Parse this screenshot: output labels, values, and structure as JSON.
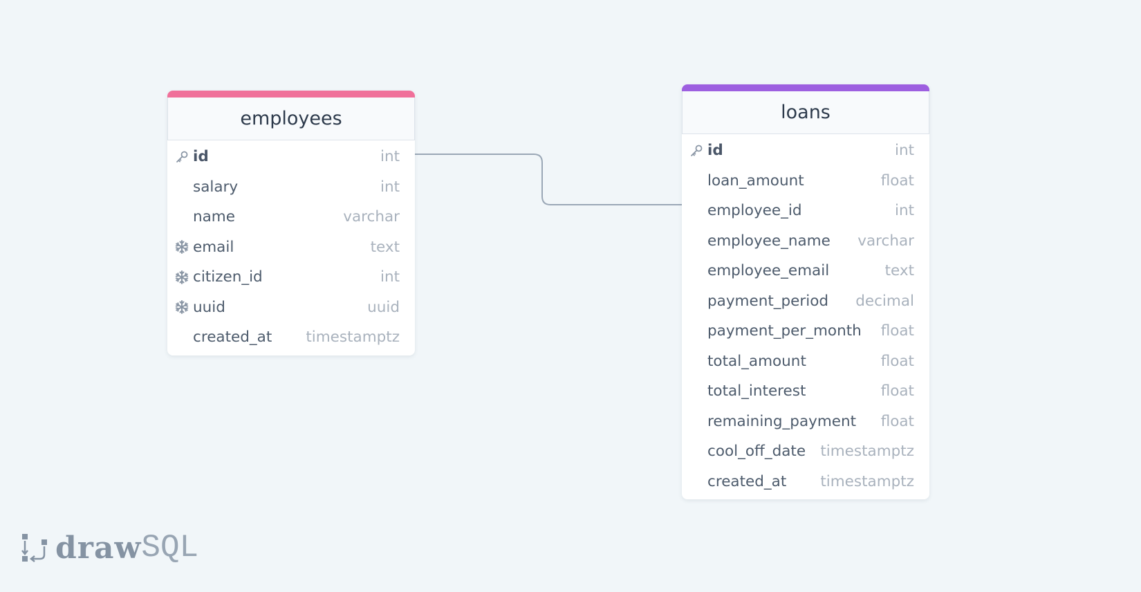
{
  "colors": {
    "employees_accent": "#f0709a",
    "loans_accent": "#9d5fe0",
    "connector": "#9aa7b6",
    "icon": "#8a96a5"
  },
  "tables": {
    "employees": {
      "name": "employees",
      "columns": [
        {
          "name": "id",
          "type": "int",
          "icon": "key-icon",
          "primary": true
        },
        {
          "name": "salary",
          "type": "int",
          "icon": null
        },
        {
          "name": "name",
          "type": "varchar",
          "icon": null
        },
        {
          "name": "email",
          "type": "text",
          "icon": "snowflake-icon"
        },
        {
          "name": "citizen_id",
          "type": "int",
          "icon": "snowflake-icon"
        },
        {
          "name": "uuid",
          "type": "uuid",
          "icon": "snowflake-icon"
        },
        {
          "name": "created_at",
          "type": "timestamptz",
          "icon": null
        }
      ]
    },
    "loans": {
      "name": "loans",
      "columns": [
        {
          "name": "id",
          "type": "int",
          "icon": "key-icon",
          "primary": true
        },
        {
          "name": "loan_amount",
          "type": "float",
          "icon": null
        },
        {
          "name": "employee_id",
          "type": "int",
          "icon": null
        },
        {
          "name": "employee_name",
          "type": "varchar",
          "icon": null
        },
        {
          "name": "employee_email",
          "type": "text",
          "icon": null
        },
        {
          "name": "payment_period",
          "type": "decimal",
          "icon": null
        },
        {
          "name": "payment_per_month",
          "type": "float",
          "icon": null
        },
        {
          "name": "total_amount",
          "type": "float",
          "icon": null
        },
        {
          "name": "total_interest",
          "type": "float",
          "icon": null
        },
        {
          "name": "remaining_payment",
          "type": "float",
          "icon": null
        },
        {
          "name": "cool_off_date",
          "type": "timestamptz",
          "icon": null
        },
        {
          "name": "created_at",
          "type": "timestamptz",
          "icon": null
        }
      ]
    }
  },
  "relations": [
    {
      "from": "employees.id",
      "to": "loans.employee_id"
    }
  ],
  "logo": {
    "draw": "draw",
    "sql": "SQL"
  }
}
